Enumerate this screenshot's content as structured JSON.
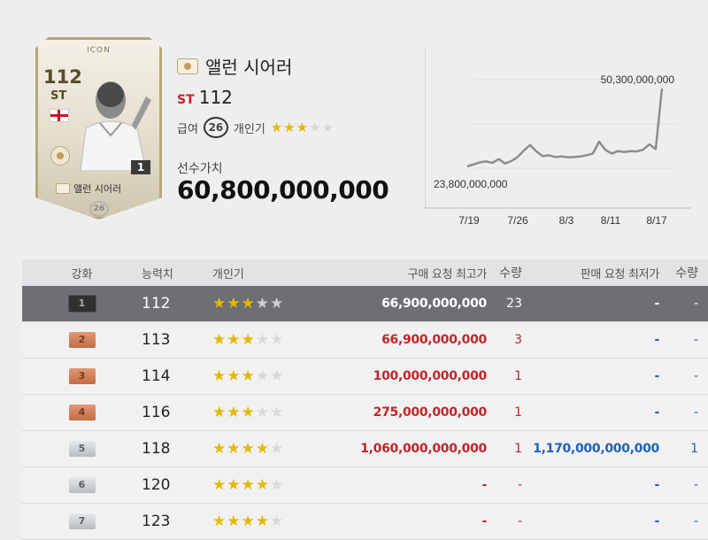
{
  "card": {
    "type_label": "ICON",
    "ovr": "112",
    "position": "ST",
    "level": "1",
    "name": "앨런 시어러",
    "pay": "26"
  },
  "info": {
    "name": "앨런 시어러",
    "position": "ST",
    "ovr": "112",
    "pay_label": "급여",
    "pay": "26",
    "trait_label": "개인기",
    "trait_stars": 3,
    "value_label": "선수가치",
    "value": "60,800,000,000"
  },
  "chart_data": {
    "type": "line",
    "x_ticks": [
      "7/19",
      "7/26",
      "8/3",
      "8/11",
      "8/17"
    ],
    "max_label": "50,300,000,000",
    "min_label": "23,800,000,000",
    "values": [
      23.8,
      24.5,
      25.2,
      25.5,
      25.0,
      26.3,
      24.8,
      25.6,
      27.0,
      29.2,
      31.1,
      28.9,
      27.3,
      27.6,
      27.0,
      27.2,
      26.9,
      27.0,
      27.2,
      27.6,
      28.2,
      32.2,
      29.4,
      28.2,
      29.0,
      28.7,
      29.0,
      28.9,
      29.5,
      31.3,
      29.7,
      50.3
    ]
  },
  "table": {
    "headers": {
      "grade": "강화",
      "ovr": "능력치",
      "trait": "개인기",
      "buy": "구매 요청 최고가",
      "buy_qty": "수량",
      "sell": "판매 요청 최저가",
      "sell_qty": "수량"
    },
    "rows": [
      {
        "grade": "1",
        "ovr": "112",
        "stars": 3,
        "buy": "66,900,000,000",
        "buy_qty": "23",
        "sell": "-",
        "sell_qty": "-"
      },
      {
        "grade": "2",
        "ovr": "113",
        "stars": 3,
        "buy": "66,900,000,000",
        "buy_qty": "3",
        "sell": "-",
        "sell_qty": "-"
      },
      {
        "grade": "3",
        "ovr": "114",
        "stars": 3,
        "buy": "100,000,000,000",
        "buy_qty": "1",
        "sell": "-",
        "sell_qty": "-"
      },
      {
        "grade": "4",
        "ovr": "116",
        "stars": 3,
        "buy": "275,000,000,000",
        "buy_qty": "1",
        "sell": "-",
        "sell_qty": "-"
      },
      {
        "grade": "5",
        "ovr": "118",
        "stars": 4,
        "buy": "1,060,000,000,000",
        "buy_qty": "1",
        "sell": "1,170,000,000,000",
        "sell_qty": "1"
      },
      {
        "grade": "6",
        "ovr": "120",
        "stars": 4,
        "buy": "-",
        "buy_qty": "-",
        "sell": "-",
        "sell_qty": "-"
      },
      {
        "grade": "7",
        "ovr": "123",
        "stars": 4,
        "buy": "-",
        "buy_qty": "-",
        "sell": "-",
        "sell_qty": "-"
      }
    ]
  }
}
